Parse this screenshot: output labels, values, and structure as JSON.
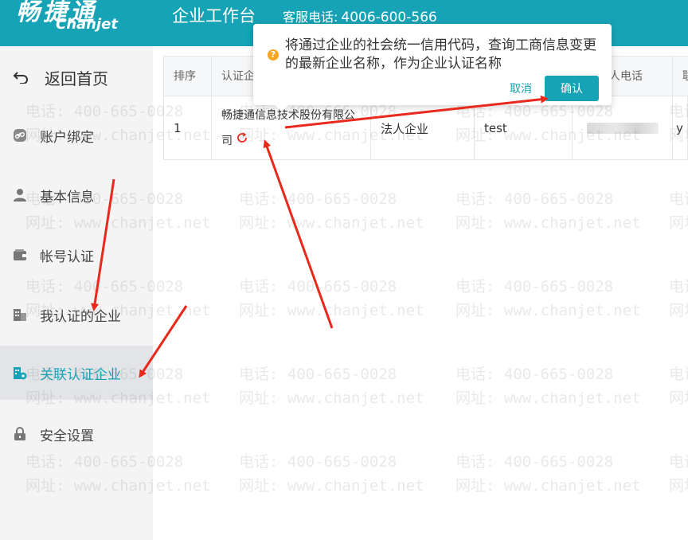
{
  "header": {
    "logo_cn": "畅捷通",
    "logo_en": "Chanjet",
    "app_title": "企业工作台",
    "service_label": "客服电话:",
    "service_number": "4006-600-566",
    "bg_color": "#17a3b6"
  },
  "sidebar": {
    "back_home": "返回首页",
    "items": [
      {
        "label": "账户绑定",
        "icon": "link-icon"
      },
      {
        "label": "基本信息",
        "icon": "user-icon"
      },
      {
        "label": "帐号认证",
        "icon": "wallet-icon"
      },
      {
        "label": "我认证的企业",
        "icon": "building-icon"
      },
      {
        "label": "关联认证企业",
        "icon": "building-link-icon",
        "active": true
      },
      {
        "label": "安全设置",
        "icon": "lock-icon"
      }
    ]
  },
  "table": {
    "headers": [
      "排序",
      "认证企",
      "",
      "",
      "人电话",
      "联"
    ],
    "rows": [
      {
        "order": "1",
        "company": "畅捷通信息技术股份有限公司",
        "type": "法人企业",
        "contact": "test",
        "phone": "",
        "extra": "y"
      }
    ]
  },
  "popconfirm": {
    "message": "将通过企业的社会统一信用代码，查询工商信息变更的最新企业名称，作为企业认证名称",
    "cancel_label": "取消",
    "ok_label": "确认"
  },
  "watermark": {
    "line1": "电话: 400-665-0028",
    "line2": "网址: www.chanjet.net"
  },
  "colors": {
    "accent": "#17a3b6",
    "annotation": "#e8291c",
    "warning": "#f5a623"
  }
}
